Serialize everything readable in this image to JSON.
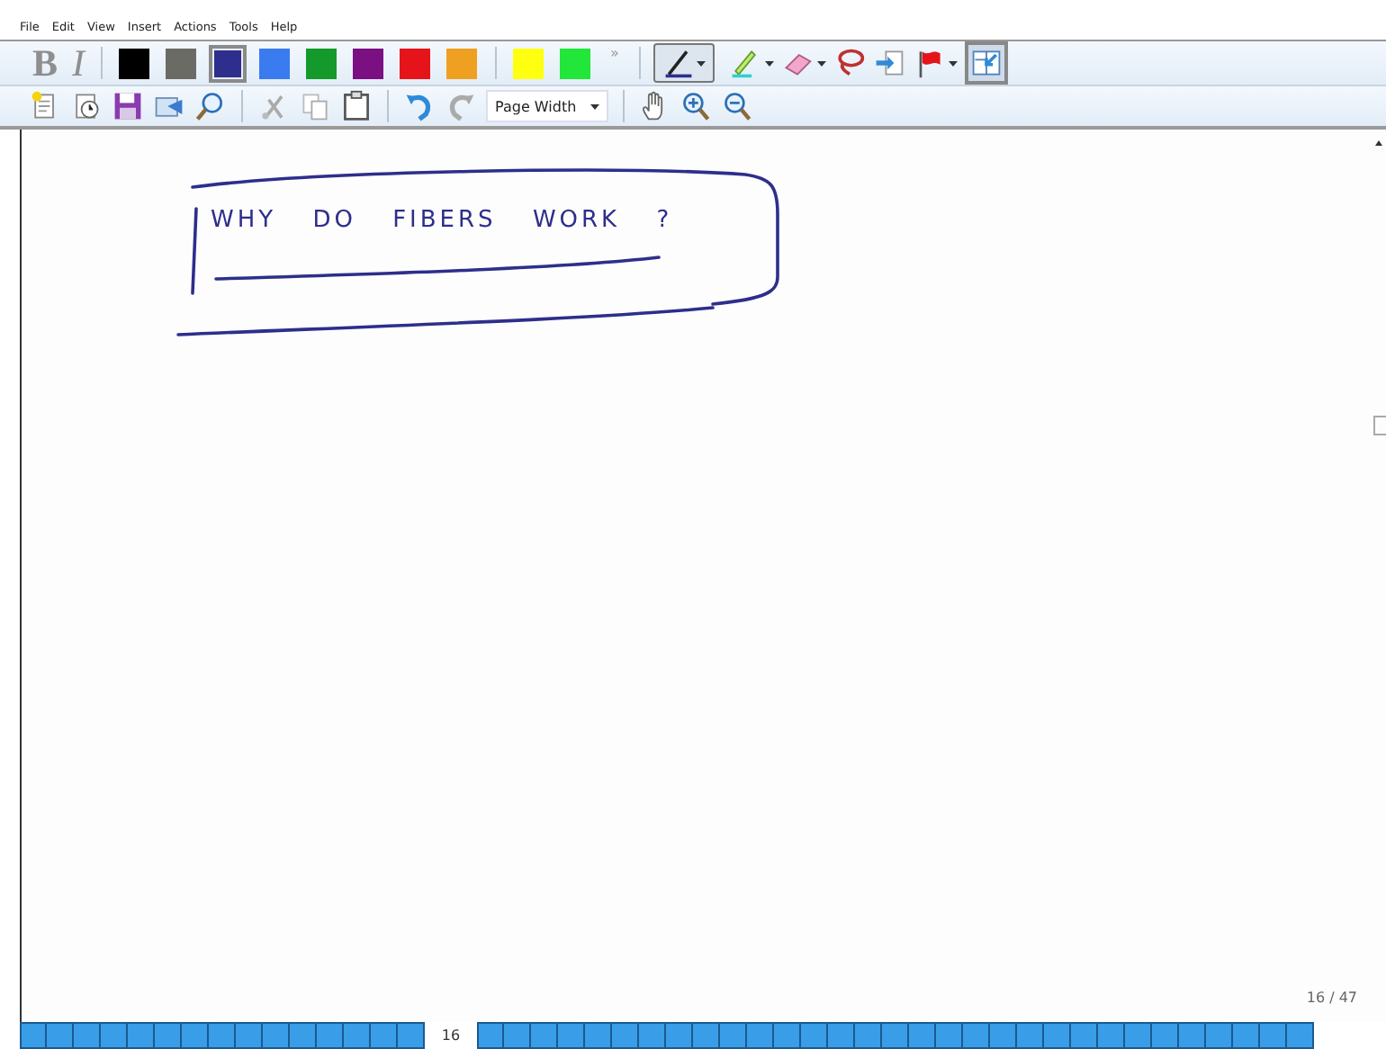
{
  "menu": [
    "File",
    "Edit",
    "View",
    "Insert",
    "Actions",
    "Tools",
    "Help"
  ],
  "format_buttons": [
    {
      "label": "B",
      "disabled": true
    },
    {
      "label": "I",
      "disabled": true
    }
  ],
  "swatches": [
    {
      "color": "#000000",
      "selected": false
    },
    {
      "color": "#6b6b66",
      "selected": false
    },
    {
      "color": "#2e2e8c",
      "selected": true
    },
    {
      "color": "#3a7bef",
      "selected": false
    },
    {
      "color": "#139a2a",
      "selected": false
    },
    {
      "color": "#7a1081",
      "selected": false
    },
    {
      "color": "#e5141b",
      "selected": false
    },
    {
      "color": "#f0a020",
      "selected": false
    },
    {
      "color": "#ffff10",
      "selected": false
    },
    {
      "color": "#22e63a",
      "selected": false
    }
  ],
  "more": "»",
  "tools": {
    "pen_selected": true,
    "panel_selected": true
  },
  "zoom": {
    "value": "Page Width"
  },
  "note": {
    "ink_text": "WHY DO FIBERS WORK ?"
  },
  "page_indicator": "16 / 47",
  "page_strip": {
    "current": "16"
  }
}
